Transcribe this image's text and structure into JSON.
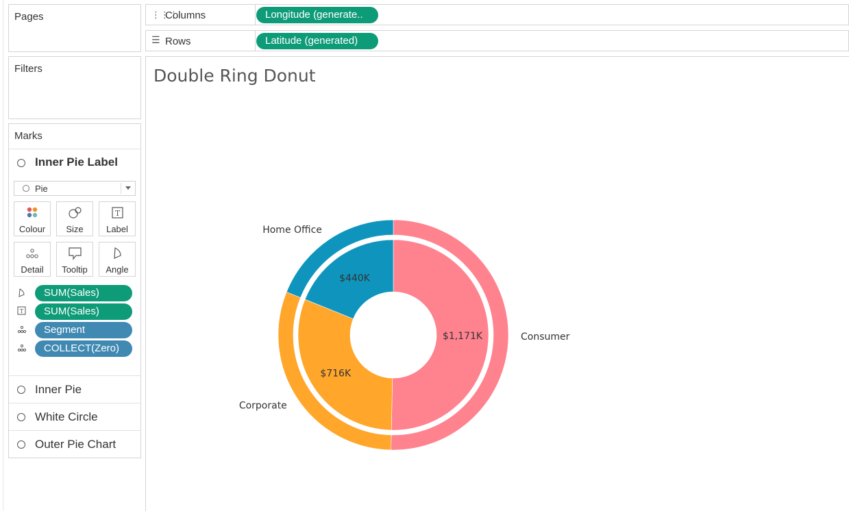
{
  "pages": {
    "title": "Pages"
  },
  "filters": {
    "title": "Filters"
  },
  "shelves": {
    "columns": {
      "label": "Columns",
      "pill": "Longitude (generate.."
    },
    "rows": {
      "label": "Rows",
      "pill": "Latitude (generated)"
    }
  },
  "marks": {
    "title": "Marks",
    "active_layer": "Inner Pie Label",
    "mark_type": "Pie",
    "buttons": {
      "colour": "Colour",
      "size": "Size",
      "label": "Label",
      "detail": "Detail",
      "tooltip": "Tooltip",
      "angle": "Angle"
    },
    "fields": [
      {
        "label": "SUM(Sales)",
        "role": "angle",
        "color": "#0e9b78"
      },
      {
        "label": "SUM(Sales)",
        "role": "label",
        "color": "#0e9b78"
      },
      {
        "label": "Segment",
        "role": "detail",
        "color": "#3f89b2"
      },
      {
        "label": "COLLECT(Zero)",
        "role": "detail",
        "color": "#3f89b2"
      }
    ],
    "layers": [
      "Inner Pie",
      "White Circle",
      "Outer Pie Chart"
    ]
  },
  "worksheet": {
    "title": "Double Ring Donut"
  },
  "chart_data": {
    "type": "pie",
    "categories": [
      "Consumer",
      "Corporate",
      "Home Office"
    ],
    "values": [
      1171,
      716,
      440
    ],
    "value_labels": [
      "$1,171K",
      "$716K",
      "$440K"
    ],
    "colors": [
      "#ff828f",
      "#ffa62b",
      "#0f95bd"
    ],
    "rings": [
      "inner donut with value labels",
      "outer ring with category labels"
    ]
  }
}
